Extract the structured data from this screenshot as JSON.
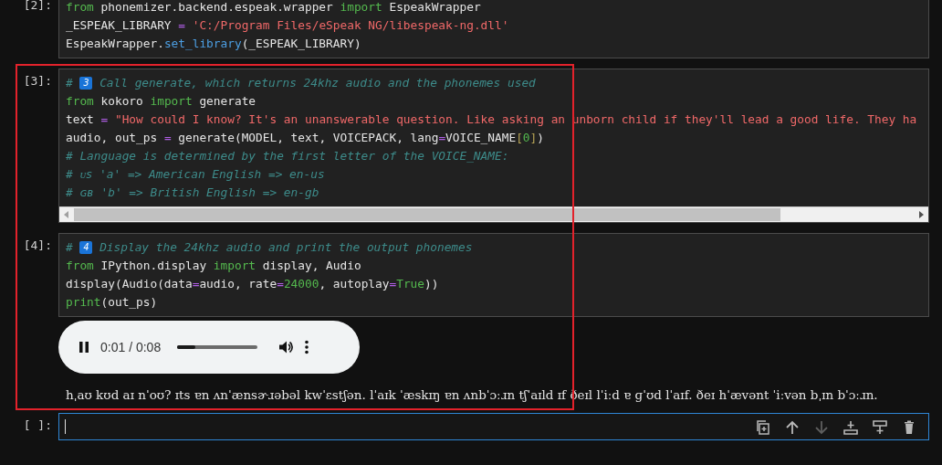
{
  "cells": [
    {
      "prompt": "[2]:",
      "selected": false,
      "lines": [
        [
          {
            "kind": "kw",
            "text": "from"
          },
          {
            "kind": "name",
            "text": " phonemizer.backend.espeak.wrapper "
          },
          {
            "kind": "kw",
            "text": "import"
          },
          {
            "kind": "name",
            "text": " EspeakWrapper"
          }
        ],
        [
          {
            "kind": "name",
            "text": "_ESPEAK_LIBRARY "
          },
          {
            "kind": "op",
            "text": "="
          },
          {
            "kind": "str",
            "text": " 'C:/Program Files/eSpeak NG/libespeak-ng.dll'"
          }
        ],
        [
          {
            "kind": "name",
            "text": "EspeakWrapper."
          },
          {
            "kind": "fn",
            "text": "set_library"
          },
          {
            "kind": "name",
            "text": "(_ESPEAK_LIBRARY)"
          }
        ]
      ]
    },
    {
      "prompt": "[3]:",
      "selected": false,
      "horizontal_scrollbar": true,
      "lines": [
        [
          {
            "kind": "com",
            "text": "# "
          },
          {
            "kind": "badge",
            "text": "3"
          },
          {
            "kind": "com",
            "text": " Call generate, which returns 24khz audio and the phonemes used"
          }
        ],
        [
          {
            "kind": "kw",
            "text": "from"
          },
          {
            "kind": "name",
            "text": " kokoro "
          },
          {
            "kind": "kw",
            "text": "import"
          },
          {
            "kind": "name",
            "text": " generate"
          }
        ],
        [
          {
            "kind": "name",
            "text": "text "
          },
          {
            "kind": "op",
            "text": "="
          },
          {
            "kind": "str",
            "text": " \"How could I know? It's an unanswerable question. Like asking an unborn child if they'll lead a good life. They ha"
          }
        ],
        [
          {
            "kind": "name",
            "text": "audio, out_ps "
          },
          {
            "kind": "op",
            "text": "="
          },
          {
            "kind": "name",
            "text": " generate(MODEL, text, VOICEPACK, lang"
          },
          {
            "kind": "op",
            "text": "="
          },
          {
            "kind": "name",
            "text": "VOICE_NAME"
          },
          {
            "kind": "brk",
            "text": "["
          },
          {
            "kind": "num",
            "text": "0"
          },
          {
            "kind": "brk",
            "text": "]"
          },
          {
            "kind": "name",
            "text": ")"
          }
        ],
        [
          {
            "kind": "com",
            "text": "# Language is determined by the first letter of the VOICE_NAME:"
          }
        ],
        [
          {
            "kind": "com",
            "text": "# ᴜs 'a' => American English => en-us"
          }
        ],
        [
          {
            "kind": "com",
            "text": "# ɢʙ 'b' => British English => en-gb"
          }
        ]
      ]
    },
    {
      "prompt": "[4]:",
      "selected": false,
      "lines": [
        [
          {
            "kind": "com",
            "text": "# "
          },
          {
            "kind": "badge",
            "text": "4"
          },
          {
            "kind": "com",
            "text": " Display the 24khz audio and print the output phonemes"
          }
        ],
        [
          {
            "kind": "kw",
            "text": "from"
          },
          {
            "kind": "name",
            "text": " IPython.display "
          },
          {
            "kind": "kw",
            "text": "import"
          },
          {
            "kind": "name",
            "text": " display, Audio"
          }
        ],
        [
          {
            "kind": "name",
            "text": "display(Audio(data"
          },
          {
            "kind": "op",
            "text": "="
          },
          {
            "kind": "name",
            "text": "audio, rate"
          },
          {
            "kind": "op",
            "text": "="
          },
          {
            "kind": "num",
            "text": "24000"
          },
          {
            "kind": "name",
            "text": ", autoplay"
          },
          {
            "kind": "op",
            "text": "="
          },
          {
            "kind": "num",
            "text": "True"
          },
          {
            "kind": "name",
            "text": "))"
          }
        ],
        [
          {
            "kind": "kw",
            "text": "print"
          },
          {
            "kind": "name",
            "text": "(out_ps)"
          }
        ]
      ],
      "audio": {
        "time": "0:01 / 0:08",
        "level": 0.22,
        "playing": true
      },
      "output": "hˌaʊ kʊd aɪ nˈoʊ? ɪts ɐn ʌnˈænsɚɹəbəl kwˈɛstʃən. lˈaɪk ˈæskɪŋ ɐn ʌnbˈɔːɹn tʃˈaɪld ɪf ðeɪl lˈiːd ɐ ɡˈʊd lˈaɪf. ðeɪ hˈævənt ˈiːvən bˌɪn bˈɔːɹn."
    },
    {
      "prompt": "[ ]:",
      "selected": true,
      "toolbar": [
        {
          "kind": "duplicate",
          "disabled": false
        },
        {
          "kind": "up",
          "disabled": false
        },
        {
          "kind": "down",
          "disabled": true
        },
        {
          "kind": "insert-below",
          "disabled": false
        },
        {
          "kind": "insert-above",
          "disabled": false
        },
        {
          "kind": "delete",
          "disabled": false
        }
      ]
    }
  ]
}
